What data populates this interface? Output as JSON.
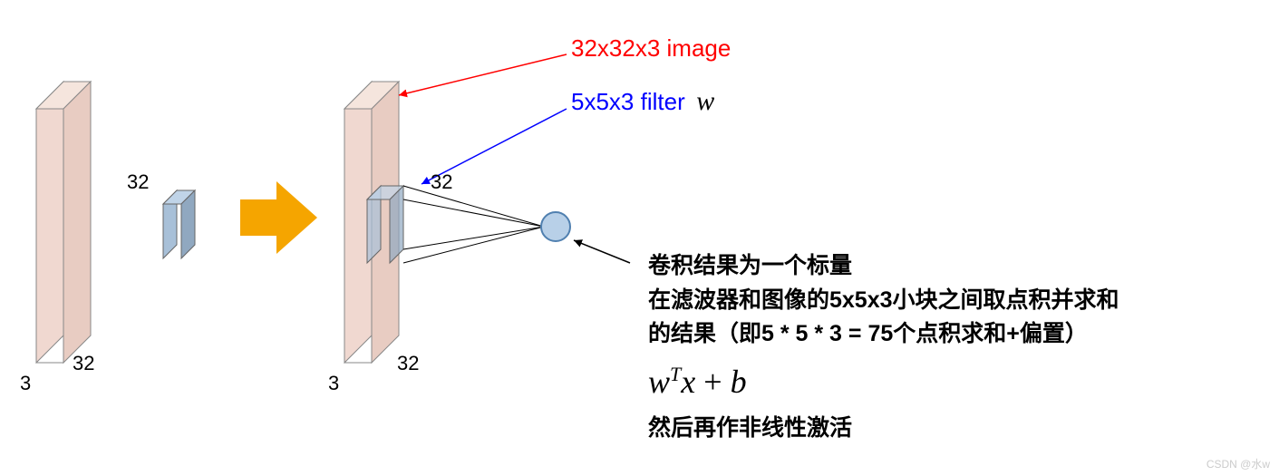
{
  "labels": {
    "image_label": "32x32x3 image",
    "filter_label": "5x5x3 filter",
    "filter_var": "w",
    "dim32_a": "32",
    "dim32_b": "32",
    "dim3_a": "3",
    "dim32_c": "32",
    "dim32_d": "32",
    "dim3_b": "3"
  },
  "description": {
    "line1": "卷积结果为一个标量",
    "line2": "在滤波器和图像的5x5x3小块之间取点积并求和",
    "line3": "的结果（即5 * 5 * 3 = 75个点积求和+偏置）",
    "formula_w": "w",
    "formula_T": "T",
    "formula_x": "x",
    "formula_plus": " + ",
    "formula_b": "b",
    "line4": "然后再作非线性激活"
  },
  "watermark": "CSDN @水w"
}
